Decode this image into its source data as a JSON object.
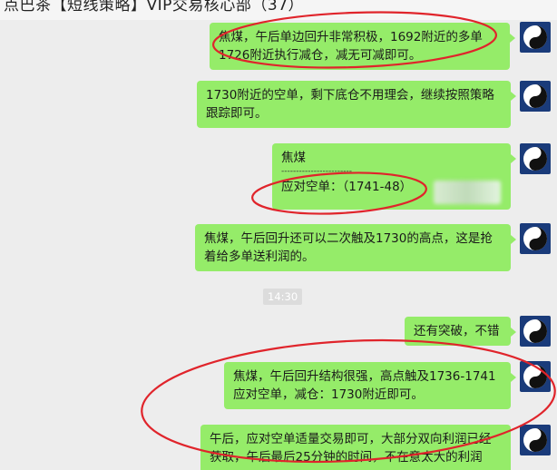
{
  "header": {
    "title": "点巴茶【短线策略】VIP交易核心部（37）"
  },
  "time_divider": "14:30",
  "messages": [
    {
      "lines": [
        "焦煤，午后单边回升非常积极，1692附近的多单",
        "1726附近执行减仓，减无可减即可。"
      ]
    },
    {
      "lines": [
        "1730附近的空单，剩下底仓不用理会，继续按照策略",
        "跟踪即可。"
      ]
    },
    {
      "lines": [
        "焦煤",
        "------------------------",
        "应对空单：（1741-48）"
      ]
    },
    {
      "lines": [
        "焦煤，午后回升还可以二次触及1730的高点，这是抢",
        "着给多单送利润的。"
      ]
    },
    {
      "lines": [
        "还有突破，不错"
      ]
    },
    {
      "lines": [
        "焦煤，午后回升结构很强，高点触及1736-1741",
        "应对空单，减仓：1730附近即可。"
      ]
    },
    {
      "lines": [
        "午后，应对空单适量交易即可，大部分双向利润已经",
        "获取，午后最后25分钟的时间，不在意太大的利润"
      ]
    }
  ],
  "colors": {
    "bubble_green": "#95ec69",
    "chat_background": "#ededed",
    "annotation_red": "#e0242b",
    "avatar_blue": "#1a3b7a"
  },
  "avatar_icon": "yin-yang-icon"
}
